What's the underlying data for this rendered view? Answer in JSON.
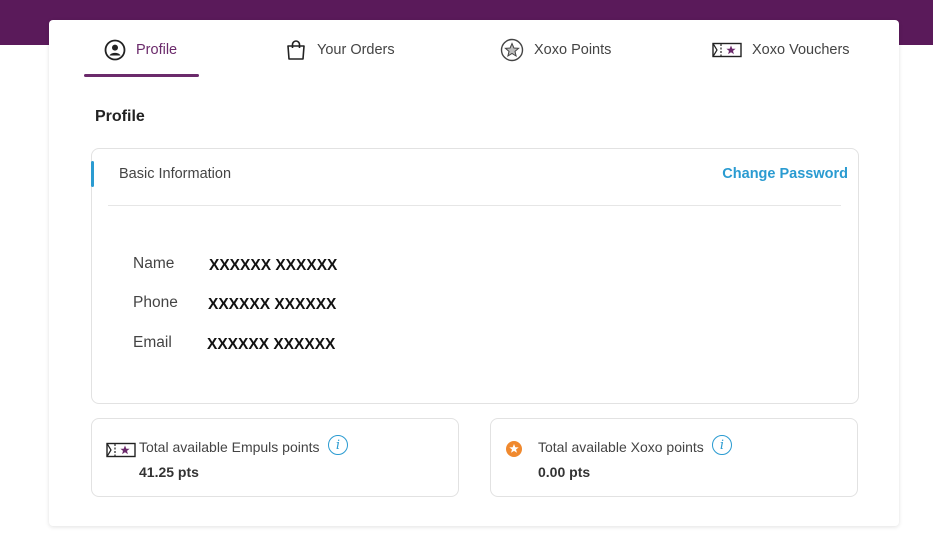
{
  "tabs": [
    {
      "label": "Profile",
      "icon": "user-circle-icon",
      "active": true
    },
    {
      "label": "Your Orders",
      "icon": "shopping-bag-icon",
      "active": false
    },
    {
      "label": "Xoxo Points",
      "icon": "star-circle-icon",
      "active": false
    },
    {
      "label": "Xoxo Vouchers",
      "icon": "voucher-ticket-icon",
      "active": false
    }
  ],
  "page": {
    "title": "Profile"
  },
  "basic_info": {
    "header": "Basic Information",
    "change_password": "Change Password",
    "fields": [
      {
        "label": "Name",
        "value": "XXXXXX XXXXXX"
      },
      {
        "label": "Phone",
        "value": "XXXXXX XXXXXX"
      },
      {
        "label": "Email",
        "value": "XXXXXX XXXXXX"
      }
    ]
  },
  "points": [
    {
      "label": "Total available Empuls points",
      "value": "41.25 pts",
      "icon": "voucher-ticket-icon"
    },
    {
      "label": "Total available Xoxo points",
      "value": "0.00 pts",
      "icon": "orange-star-badge-icon"
    }
  ],
  "colors": {
    "brand_purple": "#5a1a5a",
    "active_tab": "#6b2a6b",
    "link_blue": "#2a9bd1",
    "badge_orange": "#f0892e"
  }
}
